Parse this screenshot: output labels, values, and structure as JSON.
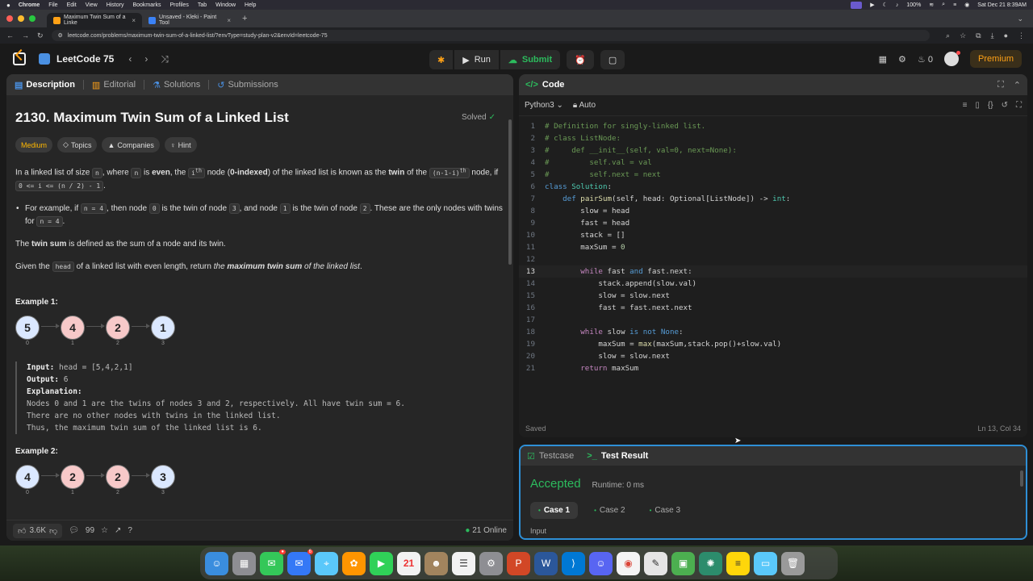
{
  "menubar": {
    "apple": "",
    "items": [
      "Chrome",
      "File",
      "Edit",
      "View",
      "History",
      "Bookmarks",
      "Profiles",
      "Tab",
      "Window",
      "Help"
    ],
    "battery": "100%",
    "datetime": "Sat Dec 21  8:39AM"
  },
  "browser": {
    "tabs": [
      {
        "title": "Maximum Twin Sum of a Linke",
        "color": "#ffa116"
      },
      {
        "title": "Unsaved - Kleki - Paint Tool",
        "color": "#3b82f6"
      }
    ],
    "url": "leetcode.com/problems/maximum-twin-sum-of-a-linked-list/?envType=study-plan-v2&envId=leetcode-75"
  },
  "nav": {
    "list_name": "LeetCode 75",
    "run_label": "Run",
    "submit_label": "Submit",
    "fire_count": "0",
    "premium_label": "Premium"
  },
  "left": {
    "tabs": [
      "Description",
      "Editorial",
      "Solutions",
      "Submissions"
    ],
    "title": "2130. Maximum Twin Sum of a Linked List",
    "solved": "Solved",
    "tags": [
      "Medium",
      "Topics",
      "Companies",
      "Hint"
    ],
    "example1_heading": "Example 1:",
    "example1_nodes": [
      {
        "val": "5",
        "idx": "0",
        "color": "blue"
      },
      {
        "val": "4",
        "idx": "1",
        "color": "pink"
      },
      {
        "val": "2",
        "idx": "2",
        "color": "pink"
      },
      {
        "val": "1",
        "idx": "3",
        "color": "blue"
      }
    ],
    "example1_input_label": "Input:",
    "example1_input": " head = [5,4,2,1]",
    "example1_output_label": "Output:",
    "example1_output": " 6",
    "example1_expl_label": "Explanation:",
    "example1_expl": [
      "Nodes 0 and 1 are the twins of nodes 3 and 2, respectively. All have twin sum = 6.",
      "There are no other nodes with twins in the linked list.",
      "Thus, the maximum twin sum of the linked list is 6."
    ],
    "example2_heading": "Example 2:",
    "example2_nodes": [
      {
        "val": "4",
        "idx": "0",
        "color": "blue"
      },
      {
        "val": "2",
        "idx": "1",
        "color": "pink"
      },
      {
        "val": "2",
        "idx": "2",
        "color": "pink"
      },
      {
        "val": "3",
        "idx": "3",
        "color": "blue"
      }
    ],
    "likes": "3.6K",
    "comments": "99",
    "online": "21 Online"
  },
  "code": {
    "header": "Code",
    "language": "Python3",
    "mode": "Auto",
    "status_left": "Saved",
    "status_right": "Ln 13, Col 34"
  },
  "test": {
    "tabs": [
      "Testcase",
      "Test Result"
    ],
    "verdict": "Accepted",
    "runtime": "Runtime: 0 ms",
    "cases": [
      "Case 1",
      "Case 2",
      "Case 3"
    ],
    "input_label": "Input"
  },
  "dock": {
    "calendar_day": "21",
    "mail_badge": "6"
  }
}
